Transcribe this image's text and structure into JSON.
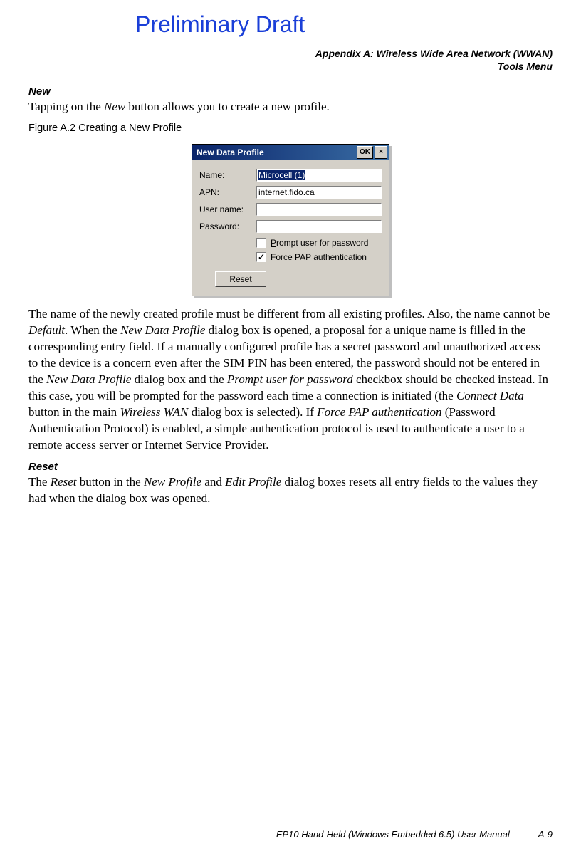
{
  "watermark": "Preliminary Draft",
  "header": {
    "line1": "Appendix A: Wireless Wide Area Network (WWAN)",
    "line2": "Tools Menu"
  },
  "section_new": {
    "title": "New",
    "p1_pre": "Tapping on the ",
    "p1_ital1": "New",
    "p1_post": " button allows you to create a new profile."
  },
  "figure_caption": "Figure A.2  Creating a New Profile",
  "dialog": {
    "title": "New Data Profile",
    "ok": "OK",
    "close": "×",
    "labels": {
      "name": "Name:",
      "apn": "APN:",
      "user": "User name:",
      "password": "Password:"
    },
    "fields": {
      "name": "Microcell (1)",
      "apn": "internet.fido.ca",
      "user": "",
      "password": ""
    },
    "check_prompt": {
      "checked": false,
      "underline": "P",
      "rest": "rompt user for password"
    },
    "check_force": {
      "checked": true,
      "underline": "F",
      "rest": "orce PAP authentication"
    },
    "reset": {
      "underline": "R",
      "rest": "eset"
    }
  },
  "para2": {
    "t1": "The name of the newly created profile must be different from all existing profiles. Also, the name cannot be ",
    "i1": "Default",
    "t2": ". When the ",
    "i2": "New Data Profile",
    "t3": " dialog box is opened, a proposal for a unique name is filled in the corresponding entry field. If a manually configured profile has a secret password and unauthorized access to the device is a concern even after the SIM PIN has been entered, the password should not be entered in the ",
    "i3": "New Data Profile",
    "t4": " dialog box and the ",
    "i4": "Prompt user for password",
    "t5": " checkbox should be checked instead. In this case, you will be prompted for the password each time a connection is initiated (the ",
    "i5": "Connect Data",
    "t6": " button in the main ",
    "i6": "Wireless WAN",
    "t7": " dialog box is selected). If ",
    "i7": "Force PAP authentication",
    "t8": " (Password Authentication Protocol) is enabled, a simple authentication protocol is used to authenticate a user to a remote access server or Internet Service Provider."
  },
  "section_reset": {
    "title": "Reset",
    "t1": "The ",
    "i1": "Reset",
    "t2": " button in the ",
    "i2": "New Profile",
    "t3": " and ",
    "i3": "Edit Profile",
    "t4": " dialog boxes resets all entry fields to the values they had when the dialog box was opened."
  },
  "footer": {
    "manual": "EP10 Hand-Held (Windows Embedded 6.5) User Manual",
    "page": "A-9"
  }
}
